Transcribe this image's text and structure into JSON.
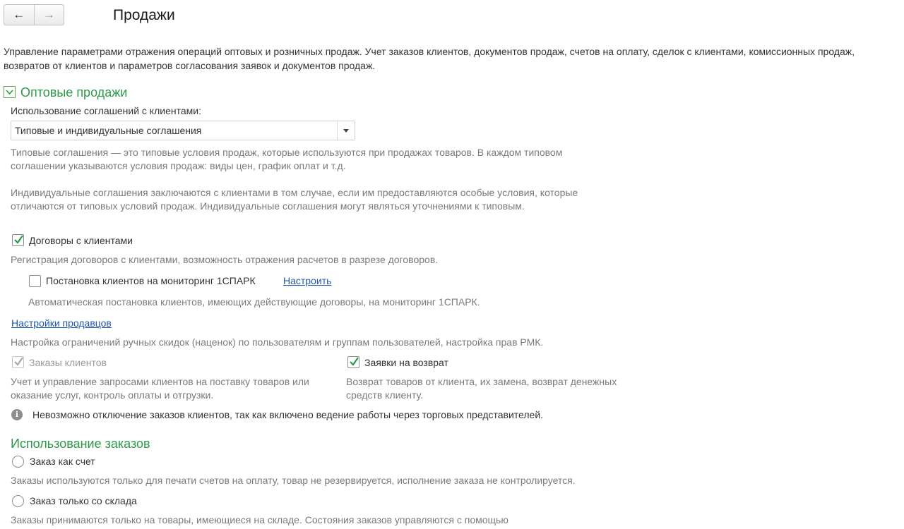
{
  "header": {
    "back_icon": "←",
    "forward_icon": "→",
    "title": "Продажи"
  },
  "description": "Управление параметрами отражения операций оптовых и розничных продаж. Учет заказов клиентов, документов продаж, счетов на оплату, сделок с клиентами, комиссионных продаж, возвратов от клиентов и параметров согласования заявок и документов продаж.",
  "wholesale": {
    "group_title": "Оптовые продажи",
    "expanded": true,
    "agreements_label": "Использование соглашений с клиентами:",
    "agreements_value": "Типовые и индивидуальные соглашения",
    "typical_hint": "Типовые соглашения — это типовые условия продаж, которые используются при продажах товаров. В каждом типовом соглашении указываются условия продаж: виды цен, график оплат и т.д.",
    "individual_hint": "Индивидуальные соглашения заключаются с клиентами в том случае, если им предоставляются особые условия, которые отличаются от типовых условий продаж. Индивидуальные соглашения могут являться уточнениями к типовым.",
    "contracts": {
      "label": "Договоры с клиентами",
      "checked": true,
      "hint": "Регистрация договоров с клиентами, возможность отражения расчетов в разрезе договоров."
    },
    "spark": {
      "label": "Постановка клиентов на мониторинг 1СПАРК",
      "checked": false,
      "link": "Настроить",
      "hint": "Автоматическая постановка клиентов, имеющих действующие договоры, на мониторинг 1СПАРК."
    },
    "sellers": {
      "link": "Настройки продавцов",
      "hint": "Настройка ограничений ручных скидок (наценок) по пользователям и группам пользователей, настройка прав РМК."
    },
    "client_orders": {
      "label": "Заказы клиентов",
      "checked": true,
      "disabled": true,
      "hint": "Учет и управление запросами клиентов на поставку товаров или оказание услуг, контроль оплаты и отгрузки."
    },
    "return_requests": {
      "label": "Заявки на возврат",
      "checked": true,
      "hint": "Возврат товаров от клиента, их замена, возврат денежных средств клиенту."
    },
    "info_icon": "i",
    "info": "Невозможно отключение заказов клиентов, так как включено ведение работы через торговых представителей."
  },
  "orders_usage": {
    "group_title": "Использование заказов",
    "options": [
      {
        "label": "Заказ как счет",
        "selected": false,
        "hint": "Заказы используются только для печати счетов на оплату, товар не резервируется, исполнение заказа не контролируется."
      },
      {
        "label": "Заказ только со склада",
        "selected": false,
        "hint": "Заказы принимаются только на товары, имеющиеся на складе. Состояния заказов управляются с помощью"
      }
    ]
  },
  "colors": {
    "accent_green": "#2a9a48",
    "link_blue": "#1d57b5",
    "muted_text": "#7a7a7a"
  }
}
